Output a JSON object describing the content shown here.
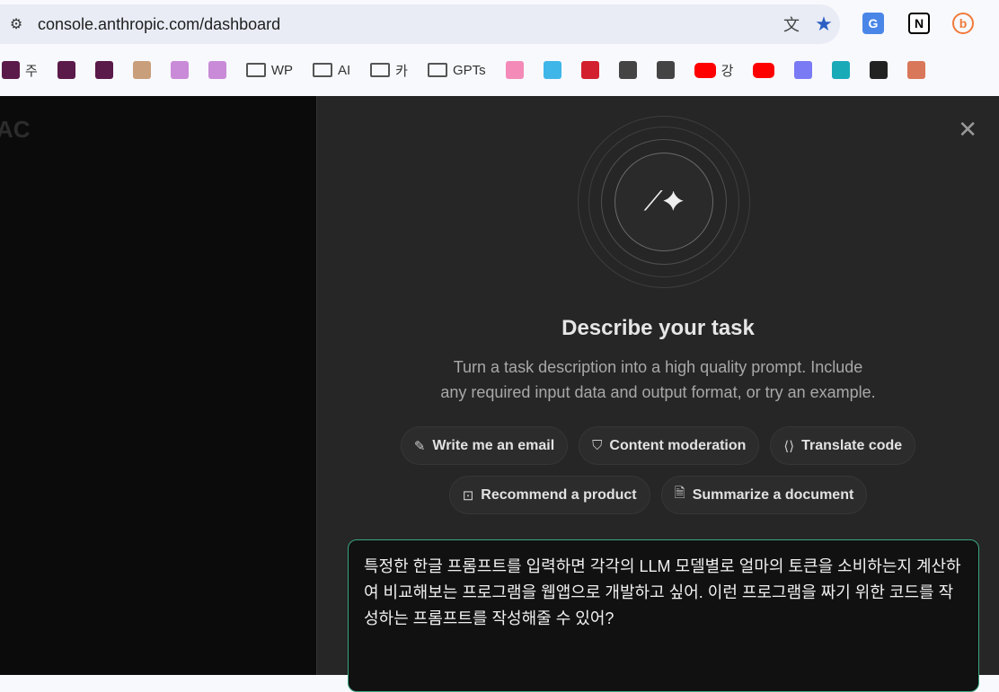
{
  "browser": {
    "url": "console.anthropic.com/dashboard",
    "bookmarks": [
      {
        "label": "주",
        "type": "site",
        "color": "#5a1a4a"
      },
      {
        "label": "",
        "type": "site",
        "color": "#5a1a4a"
      },
      {
        "label": "",
        "type": "site",
        "color": "#5a1a4a"
      },
      {
        "label": "",
        "type": "anthropic",
        "color": "#c99e7a"
      },
      {
        "label": "",
        "type": "site",
        "color": "#c98ad8"
      },
      {
        "label": "",
        "type": "site",
        "color": "#c98ad8"
      },
      {
        "label": "WP",
        "type": "folder"
      },
      {
        "label": "AI",
        "type": "folder"
      },
      {
        "label": "카",
        "type": "folder"
      },
      {
        "label": "GPTs",
        "type": "folder"
      },
      {
        "label": "",
        "type": "site",
        "color": "#f38ab8"
      },
      {
        "label": "",
        "type": "site",
        "color": "#3fb6e8"
      },
      {
        "label": "",
        "type": "site",
        "color": "#d3202e"
      },
      {
        "label": "",
        "type": "site",
        "color": "#444"
      },
      {
        "label": "",
        "type": "site",
        "color": "#444"
      },
      {
        "label": "강",
        "type": "youtube",
        "color": "#ff0000"
      },
      {
        "label": "",
        "type": "youtube",
        "color": "#ff0000"
      },
      {
        "label": "",
        "type": "site",
        "color": "#7a7af5"
      },
      {
        "label": "",
        "type": "site",
        "color": "#19aab8"
      },
      {
        "label": "",
        "type": "site",
        "color": "#222"
      },
      {
        "label": "",
        "type": "site",
        "color": "#d9775a"
      }
    ]
  },
  "background": {
    "logo_text": "AC"
  },
  "dialog": {
    "title": "Describe your task",
    "subtitle_line1": "Turn a task description into a high quality prompt. Include",
    "subtitle_line2": "any required input data and output format, or try an example.",
    "examples_row1": [
      {
        "label": "Write me an email",
        "icon": "✎"
      },
      {
        "label": "Content moderation",
        "icon": "⛉"
      },
      {
        "label": "Translate code",
        "icon": "⟨⟩"
      }
    ],
    "examples_row2": [
      {
        "label": "Recommend a product",
        "icon": "⊡"
      },
      {
        "label": "Summarize a document",
        "icon": "🗎"
      }
    ],
    "input_value": "특정한 한글 프롬프트를 입력하면 각각의 LLM 모델별로 얼마의 토큰을 소비하는지 계산하여 비교해보는 프로그램을 웹앱으로 개발하고 싶어. 이런 프로그램을 짜기 위한 코드를 작성하는 프롬프트를 작성해줄 수 있어?"
  },
  "colors": {
    "accent": "#3aa57e",
    "panel": "#262626"
  }
}
